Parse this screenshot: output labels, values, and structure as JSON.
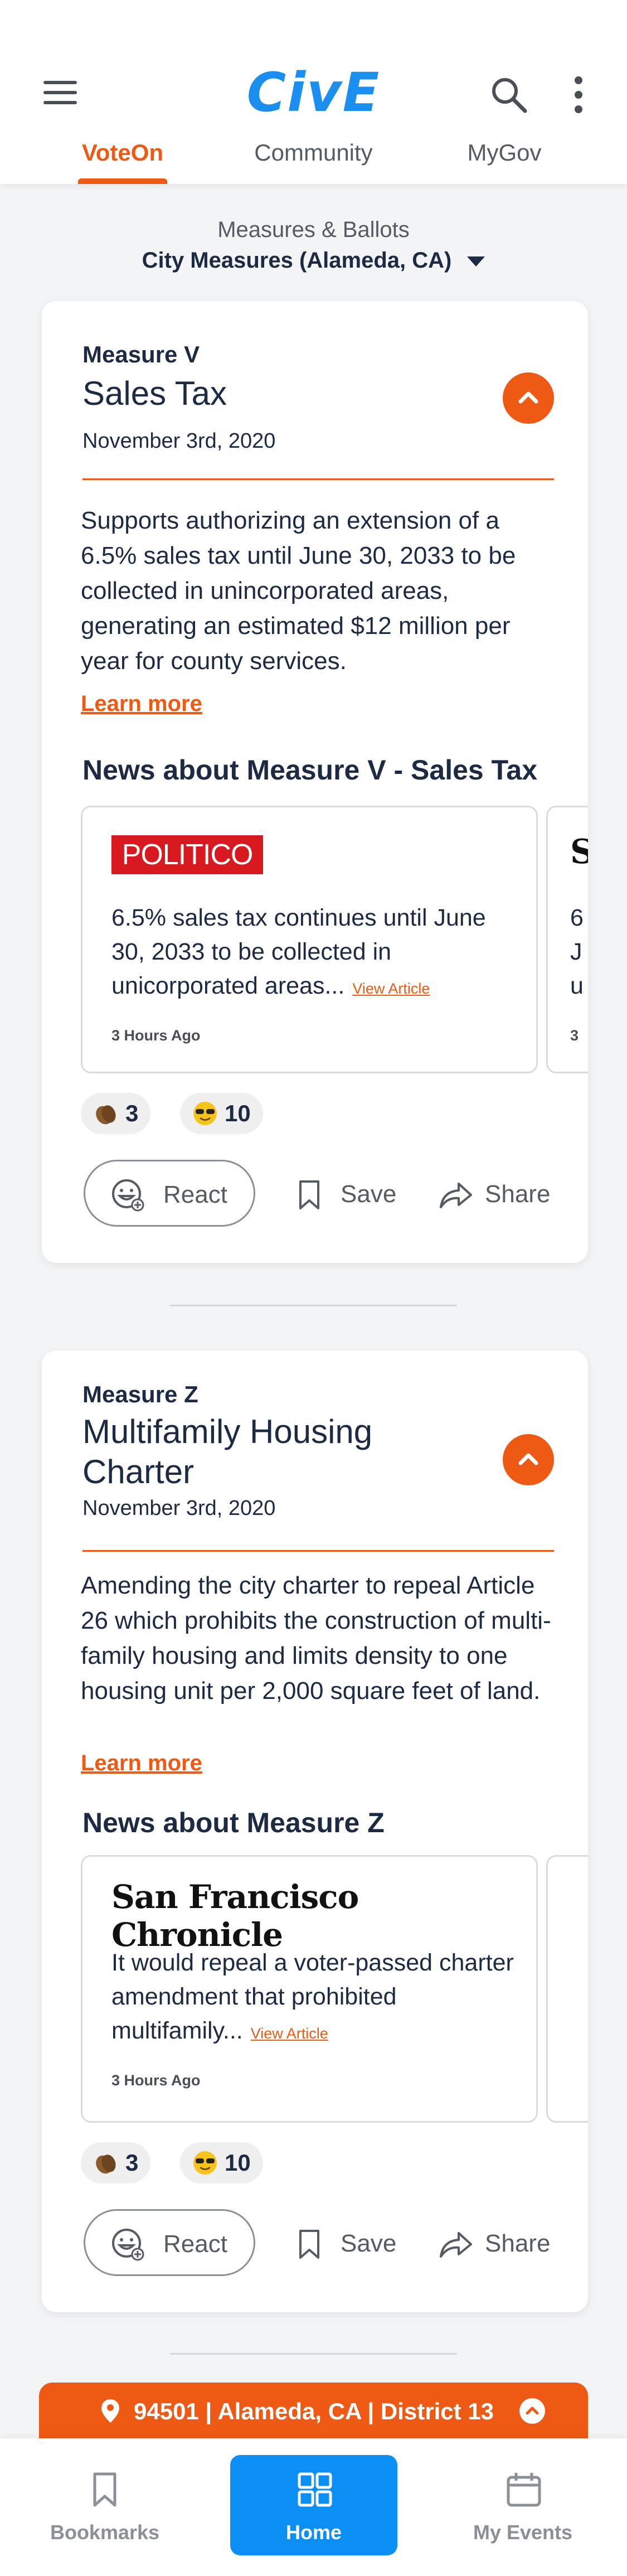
{
  "app": {
    "logo_text": "CivE",
    "brand_color": "#1a8ff0",
    "accent_color": "#ee5a14"
  },
  "header": {
    "menu_icon": "hamburger-menu-icon",
    "search_icon": "search-icon",
    "more_icon": "kebab-more-icon",
    "tabs": [
      {
        "label": "VoteOn",
        "active": true
      },
      {
        "label": "Community",
        "active": false
      },
      {
        "label": "MyGov",
        "active": false
      }
    ]
  },
  "ballot": {
    "label": "Measures & Ballots",
    "selected": "City Measures (Alameda, CA)"
  },
  "measures": [
    {
      "label": "Measure V",
      "title": "Sales Tax",
      "date": "November 3rd, 2020",
      "description": "Supports authorizing an extension of a 6.5% sales tax until June 30, 2033 to be collected in unincorporated areas, generating an estimated $12 million per year for county services.",
      "learn_more": "Learn more",
      "news_title": "News about Measure V - Sales Tax",
      "news": [
        {
          "source": "POLITICO",
          "text": "6.5% sales tax continues until June 30, 2033 to be collected in unicorporated areas...",
          "view_label": "View Article",
          "time": "3 Hours Ago"
        }
      ],
      "news_peek": {
        "glyph": "S",
        "lines": [
          "6",
          "J",
          "u"
        ],
        "time": "3"
      },
      "reactions": [
        {
          "emoji": "clapping-hands-icon",
          "count": "3"
        },
        {
          "emoji": "sunglasses-face-icon",
          "count": "10"
        }
      ],
      "actions": {
        "react": "React",
        "save": "Save",
        "share": "Share"
      }
    },
    {
      "label": "Measure Z",
      "title": "Multifamily Housing Charter",
      "date": "November 3rd, 2020",
      "description": "Amending the city charter to repeal Article 26 which prohibits the construction of multi-family housing and limits density to one housing unit per 2,000 square feet of land.",
      "learn_more": "Learn more",
      "news_title": "News about Measure Z",
      "news": [
        {
          "source": "San Francisco Chronicle",
          "text": "It would repeal a voter-passed charter amendment that prohibited multifamily...",
          "view_label": "View Article",
          "time": "3 Hours Ago"
        }
      ],
      "reactions": [
        {
          "emoji": "clapping-hands-icon",
          "count": "3"
        },
        {
          "emoji": "sunglasses-face-icon",
          "count": "10"
        }
      ],
      "actions": {
        "react": "React",
        "save": "Save",
        "share": "Share"
      }
    }
  ],
  "location": {
    "text": "94501 | Alameda, CA | District 13"
  },
  "bottom_nav": [
    {
      "label": "Bookmarks",
      "icon": "bookmark-icon",
      "active": false
    },
    {
      "label": "Home",
      "icon": "grid-icon",
      "active": true
    },
    {
      "label": "My Events",
      "icon": "calendar-icon",
      "active": false
    }
  ]
}
